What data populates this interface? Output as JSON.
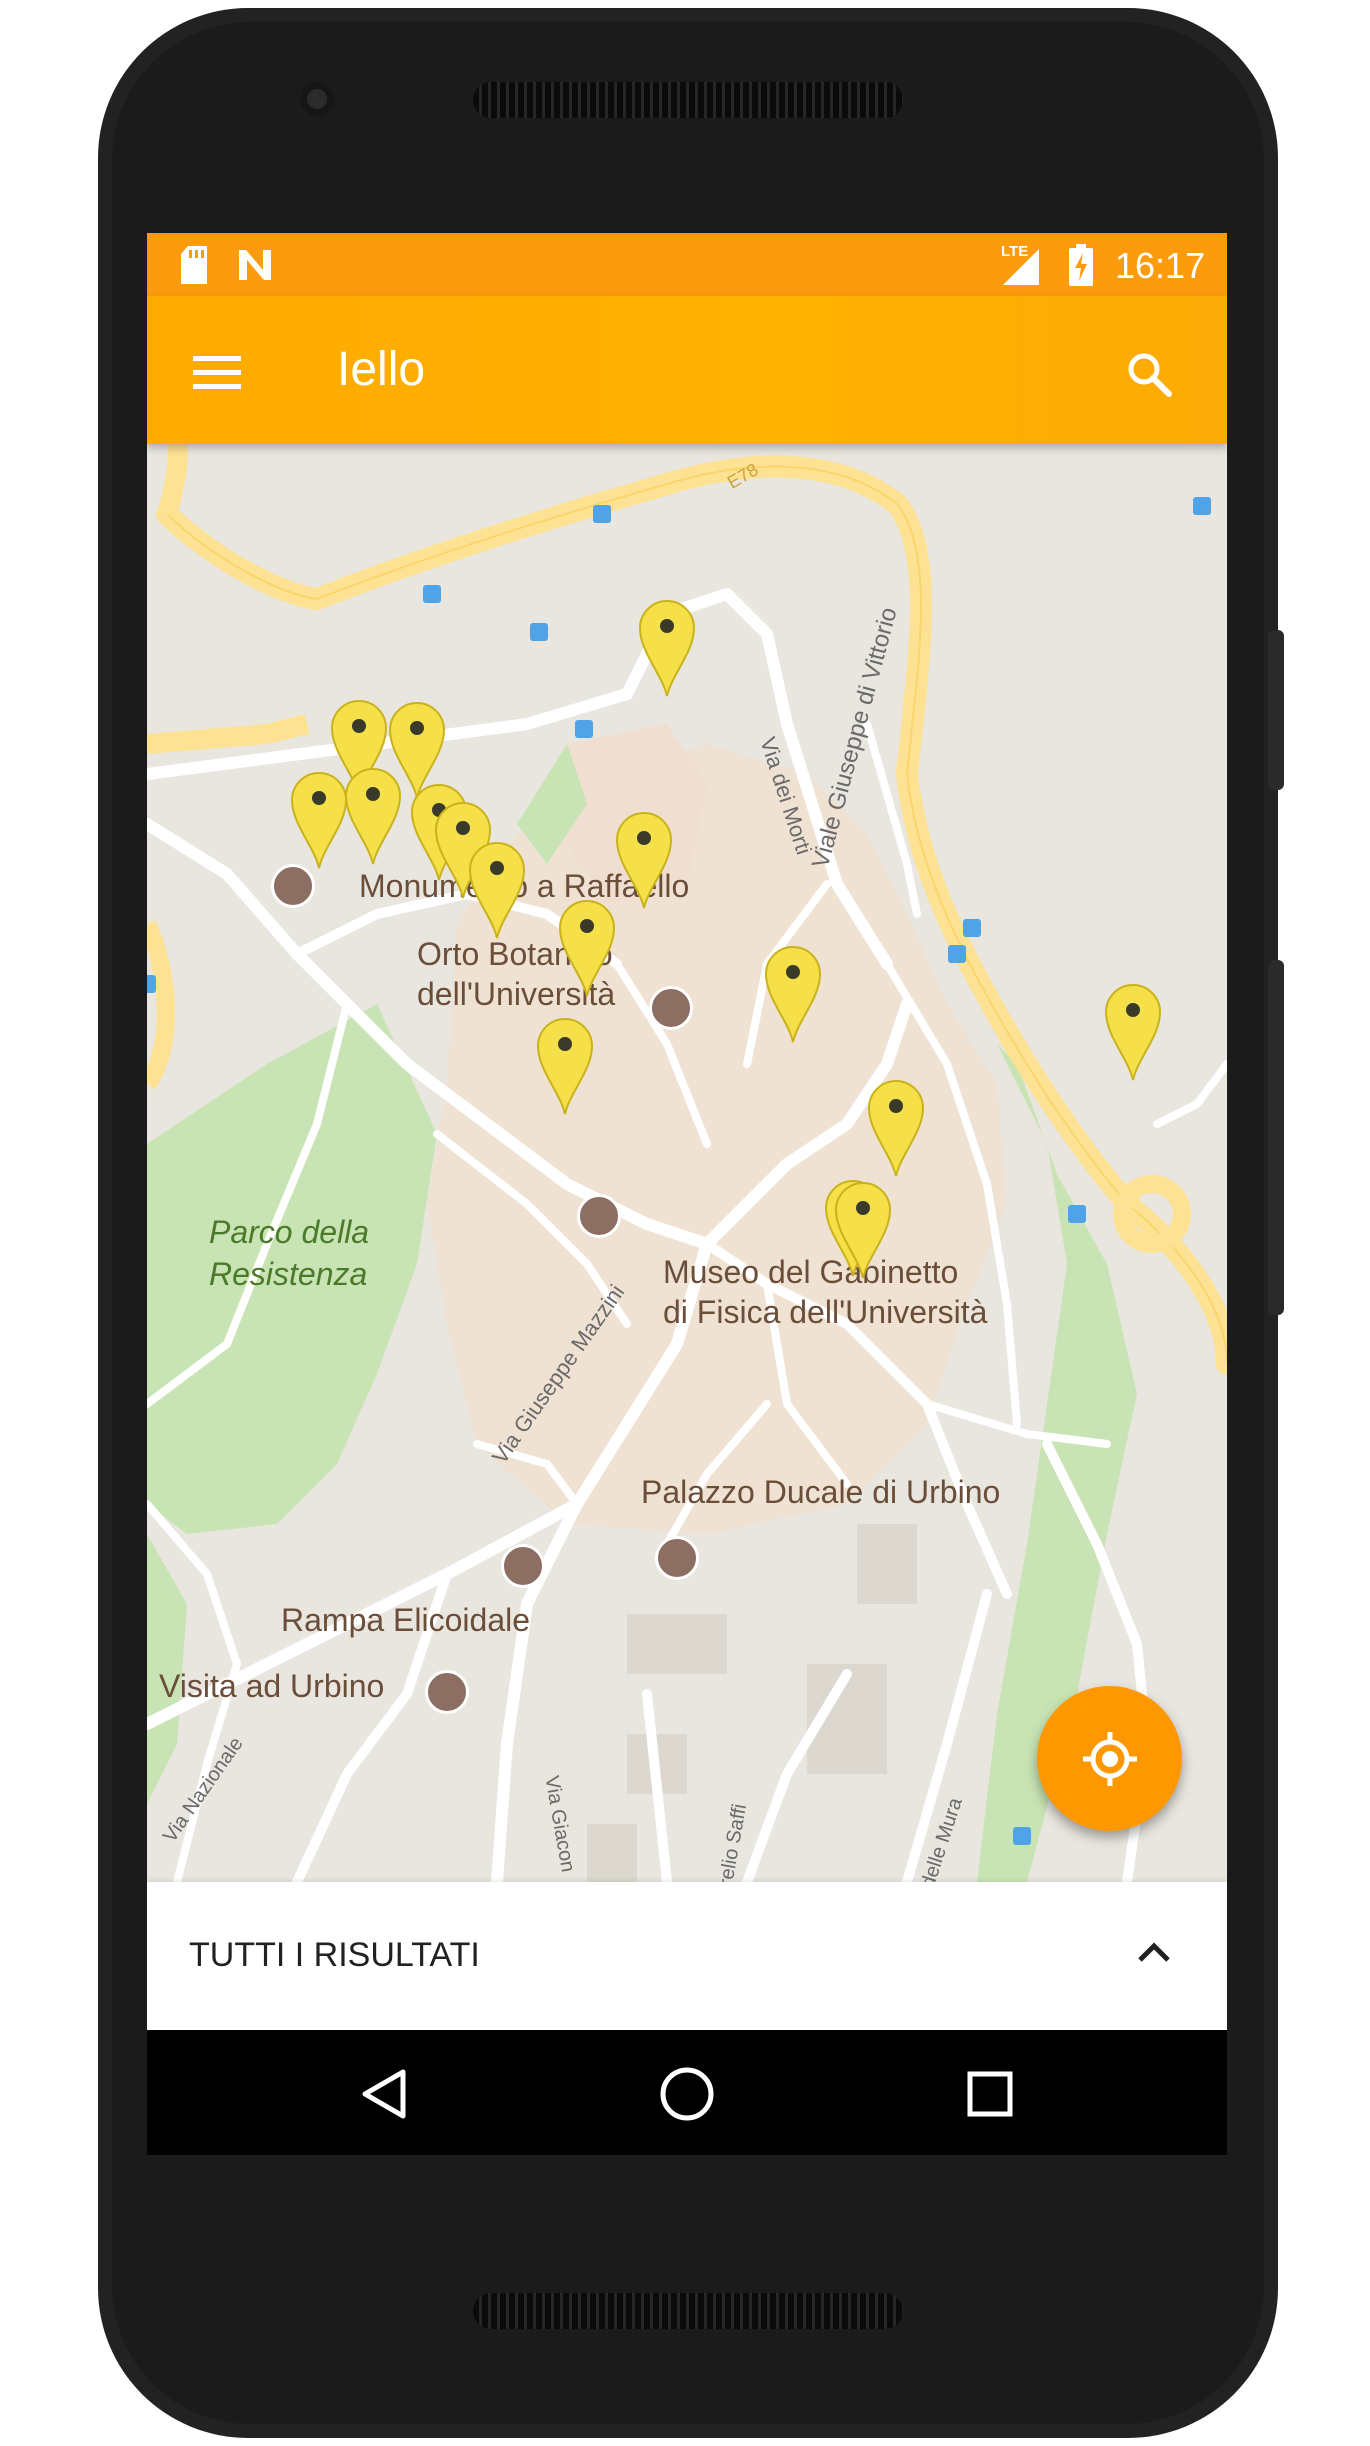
{
  "statusbar": {
    "time": "16:17",
    "network_label": "LTE",
    "left_icons": [
      "sd-card-icon",
      "nougat-icon"
    ],
    "right_icons": [
      "signal-icon",
      "battery-charging-icon"
    ]
  },
  "toolbar": {
    "title": "Iello",
    "menu_icon": "hamburger-menu-icon",
    "search_icon": "search-icon",
    "color": "#ffab00"
  },
  "map": {
    "road_labels": {
      "e78": "E78",
      "viale_vittorio": "Viale Giuseppe di Vittorio",
      "via_morti": "Via dei Morti",
      "via_mazzini": "Via Giuseppe Mazzini",
      "via_nazionale": "Via Nazionale",
      "via_giacomo": "Via Giacon",
      "via_saffi": "relio Saffi",
      "via_mura": "delle Mura"
    },
    "place_labels": {
      "monumento": "Monumento a Raffaello",
      "orto_line1": "Orto Botanico",
      "orto_line2": "dell'Università",
      "parco_line1": "Parco della",
      "parco_line2": "Resistenza",
      "museo_line1": "Museo del Gabinetto",
      "museo_line2": "di Fisica dell'Università",
      "palazzo": "Palazzo Ducale di Urbino",
      "rampa": "Rampa Elicoidale",
      "visita": "Visita ad Urbino"
    },
    "marker_color": "#f5e04a",
    "marker_count": 18
  },
  "fab": {
    "icon": "my-location-icon",
    "color": "#ff9800"
  },
  "bottom_sheet": {
    "title": "TUTTI I RISULTATI",
    "icon": "chevron-up-icon"
  },
  "navbar": {
    "icons": [
      "back-icon",
      "home-icon",
      "recents-icon"
    ]
  }
}
